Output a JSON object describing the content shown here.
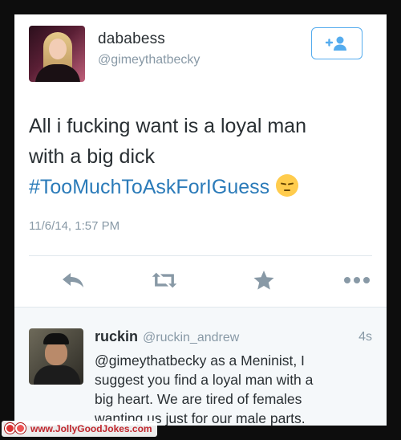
{
  "tweet": {
    "display_name": "dababess",
    "handle": "@gimeythatbecky",
    "text_lines": [
      "All i fucking want is a loyal man",
      "with a big dick"
    ],
    "hashtag": "#TooMuchToAskForIGuess",
    "timestamp": "11/6/14, 1:57 PM",
    "follow_icon": "add-user-icon",
    "actions": [
      {
        "name": "reply",
        "icon": "reply-icon"
      },
      {
        "name": "retweet",
        "icon": "retweet-icon"
      },
      {
        "name": "favorite",
        "icon": "star-icon"
      },
      {
        "name": "more",
        "icon": "more-icon"
      }
    ]
  },
  "reply": {
    "display_name": "ruckin",
    "handle": "@ruckin_andrew",
    "time": "4s",
    "text_lines": [
      "@gimeythatbecky as a Meninist, I",
      "suggest you find a loyal man with a",
      "big heart. We are tired of females",
      "wanting us just for our male parts."
    ]
  },
  "watermark": {
    "text": "www.JollyGoodJokes.com"
  },
  "colors": {
    "accent": "#55acee",
    "hashtag": "#2b7bb9",
    "muted": "#8899a6",
    "text": "#292f33",
    "icon": "#8899a6"
  }
}
